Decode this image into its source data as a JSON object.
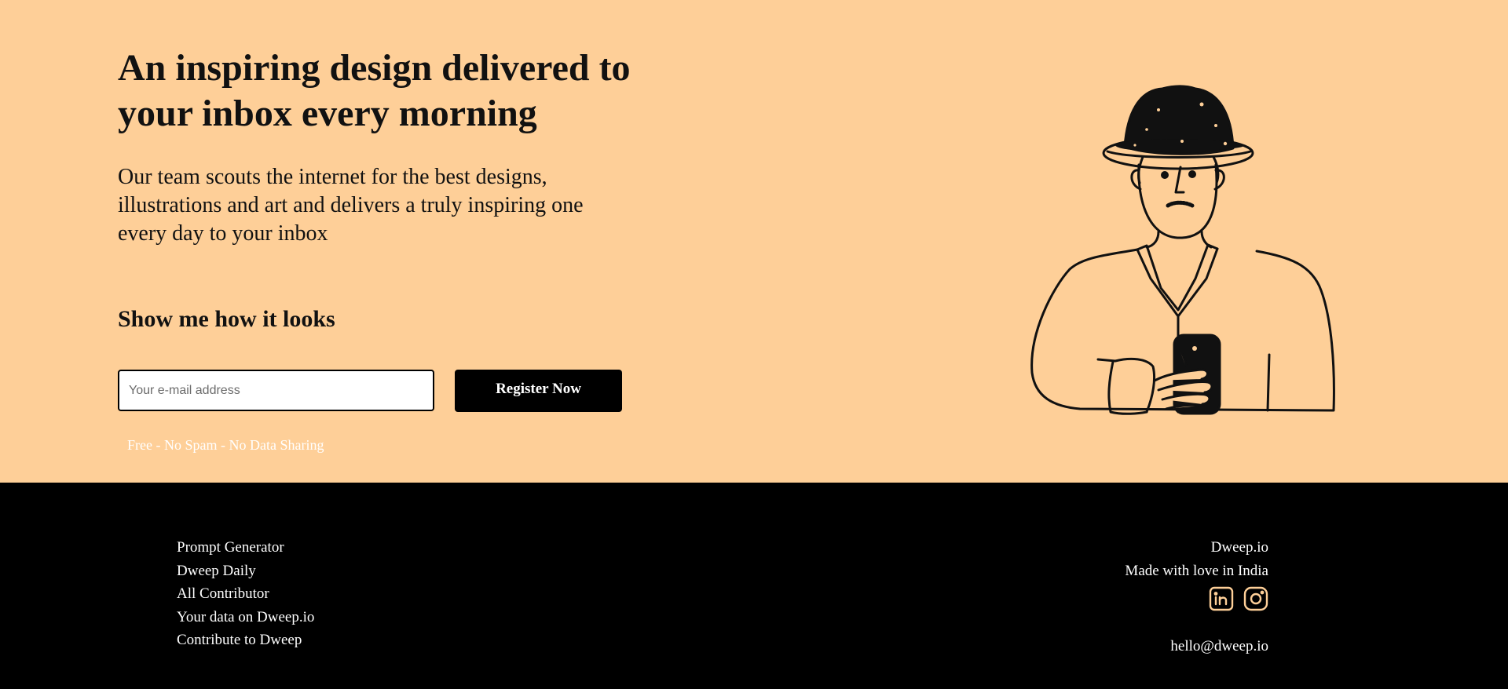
{
  "hero": {
    "headline": "An inspiring design delivered to your inbox every morning",
    "subtext": "Our team scouts the internet for the best designs, illustrations and art and delivers a truly inspiring one every day to your inbox",
    "cta_heading": "Show me how it looks",
    "email_placeholder": "Your e-mail address",
    "register_label": "Register Now",
    "disclaimer": "Free - No Spam - No Data Sharing"
  },
  "footer": {
    "links": [
      "Prompt Generator",
      "Dweep Daily",
      "All Contributor",
      "Your data on Dweep.io",
      "Contribute to Dweep"
    ],
    "brand": "Dweep.io",
    "tagline": "Made with love in India",
    "social_icons": [
      "linkedin-icon",
      "instagram-icon"
    ],
    "email": "hello@dweep.io"
  },
  "colors": {
    "hero_background": "#fecf98",
    "footer_background": "#000000",
    "icon_accent": "#fecf98",
    "button_background": "#000000"
  }
}
